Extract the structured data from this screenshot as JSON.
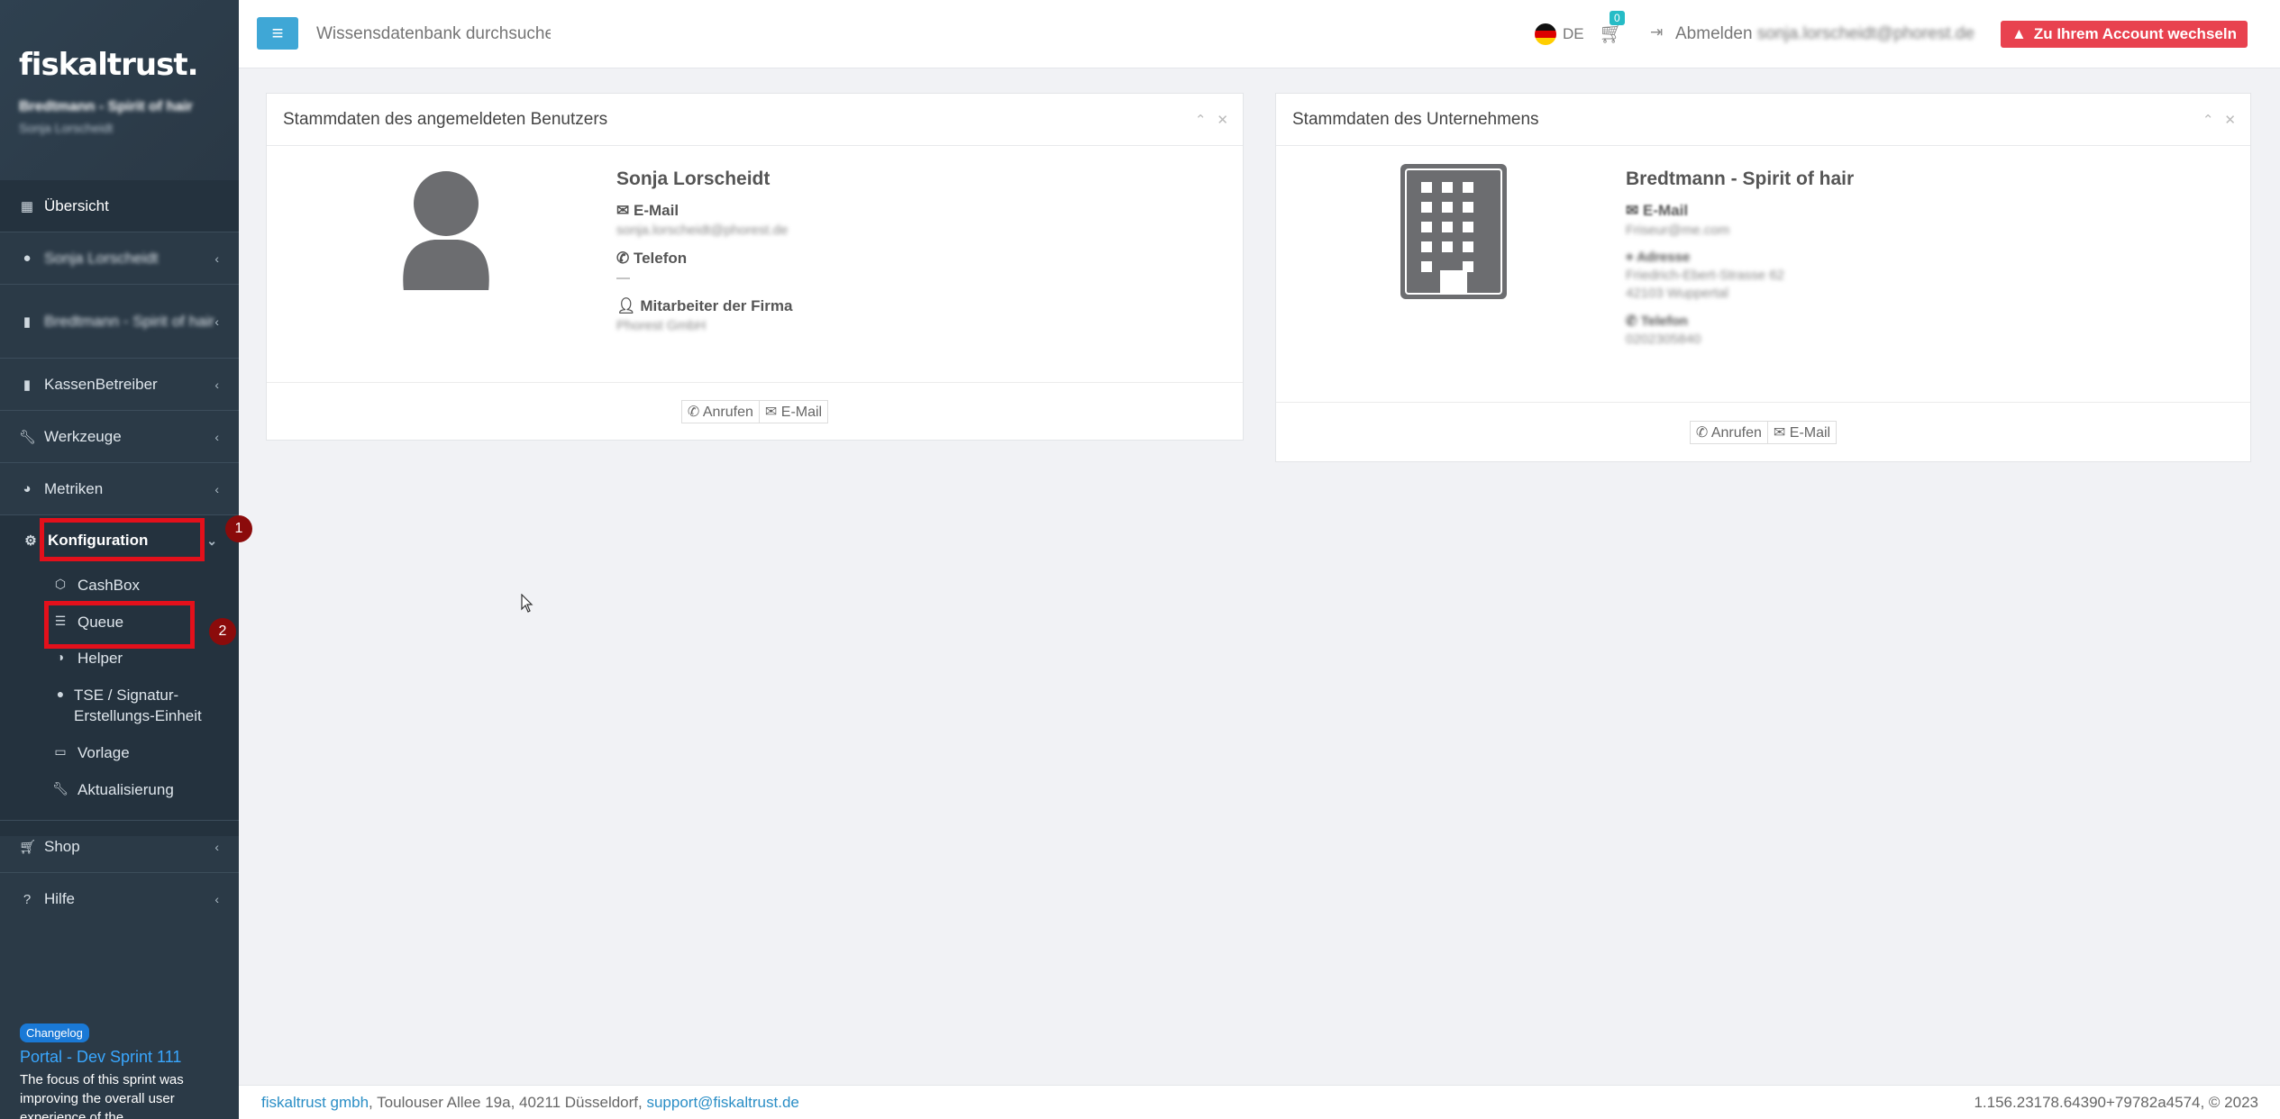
{
  "sidebar": {
    "logo": "fiskaltrust.",
    "company": "Bredtmann - Spirit of hair",
    "user": "Sonja Lorscheidt",
    "items": [
      {
        "label": "Übersicht",
        "icon": "dashboard-icon"
      },
      {
        "label": "Sonja Lorscheidt",
        "icon": "user-icon"
      },
      {
        "label": "Bredtmann - Spirit of hair",
        "icon": "building-icon"
      },
      {
        "label": "KassenBetreiber",
        "icon": "building-icon"
      },
      {
        "label": "Werkzeuge",
        "icon": "wrench-icon"
      },
      {
        "label": "Metriken",
        "icon": "pie-chart-icon"
      },
      {
        "label": "Konfiguration",
        "icon": "gears-icon"
      },
      {
        "label": "Shop",
        "icon": "cart-icon"
      },
      {
        "label": "Hilfe",
        "icon": "question-icon"
      }
    ],
    "sub_items": [
      {
        "label": "CashBox",
        "icon": "cube-icon"
      },
      {
        "label": "Queue",
        "icon": "database-icon"
      },
      {
        "label": "Helper",
        "icon": "half-circle-icon"
      },
      {
        "label": "TSE / Signatur-Erstellungs-Einheit",
        "label_line1": "TSE / Signatur-",
        "label_line2": "Erstellungs-Einheit",
        "icon": "circle-icon"
      },
      {
        "label": "Vorlage",
        "icon": "file-icon"
      },
      {
        "label": "Aktualisierung",
        "icon": "wrench-icon"
      }
    ],
    "annotations": [
      "1",
      "2"
    ],
    "changelog": {
      "badge": "Changelog",
      "title": "Portal - Dev Sprint 111",
      "text": "The focus of this sprint was improving the overall user experience of the"
    }
  },
  "topbar": {
    "search_placeholder": "Wissensdatenbank durchsuchen",
    "lang": "DE",
    "cart_count": "0",
    "logout_label": "Abmelden",
    "logout_email": "sonja.lorscheidt@phorest.de",
    "switch_account": "Zu Ihrem Account wechseln"
  },
  "user_panel": {
    "title": "Stammdaten des angemeldeten Benutzers",
    "name": "Sonja Lorscheidt",
    "email_label": "E-Mail",
    "email": "sonja.lorscheidt@phorest.de",
    "phone_label": "Telefon",
    "phone": "—",
    "employee_label": "Mitarbeiter der Firma",
    "employee": "Phorest GmbH",
    "call_btn": "Anrufen",
    "email_btn": "E-Mail"
  },
  "company_panel": {
    "title": "Stammdaten des Unternehmens",
    "name": "Bredtmann - Spirit of hair",
    "email_label": "E-Mail",
    "email": "Friseur@me.com",
    "address_label": "Adresse",
    "address_line1": "Friedrich-Ebert-Strasse 62",
    "address_line2": "42103 Wuppertal",
    "phone_label": "Telefon",
    "phone": "0202305840",
    "call_btn": "Anrufen",
    "email_btn": "E-Mail"
  },
  "footer": {
    "company_link": "fiskaltrust gmbh",
    "address": ", Toulouser Allee 19a, 40211 Düsseldorf, ",
    "support_link": "support@fiskaltrust.de",
    "version": "1.156.23178.64390+79782a4574, © 2023"
  }
}
